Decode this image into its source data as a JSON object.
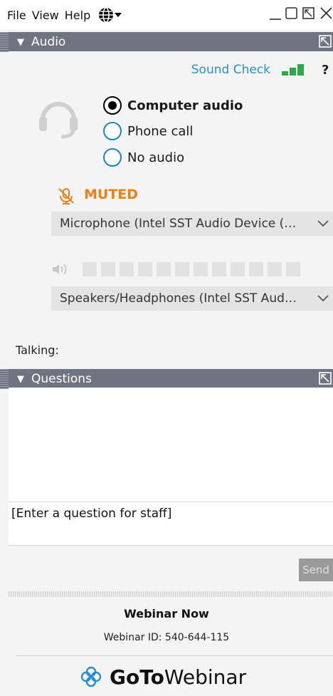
{
  "menu": {
    "file": "File",
    "view": "View",
    "help": "Help"
  },
  "audio": {
    "header": "Audio",
    "sound_check": "Sound Check",
    "help_mark": "?",
    "options": [
      {
        "label": "Computer audio",
        "selected": true
      },
      {
        "label": "Phone call",
        "selected": false
      },
      {
        "label": "No audio",
        "selected": false
      }
    ],
    "muted_label": "MUTED",
    "microphone": "Microphone (Intel SST Audio Device (…",
    "speakers": "Speakers/Headphones (Intel SST Aud…",
    "talking_label": "Talking:"
  },
  "questions": {
    "header": "Questions",
    "input_placeholder": "[Enter a question for staff]",
    "send_label": "Send"
  },
  "footer": {
    "webinar_name": "Webinar Now",
    "webinar_id": "Webinar ID: 540-644-115",
    "brand_goto": "GoTo",
    "brand_rest": "Webinar"
  },
  "colors": {
    "accent_blue": "#2b8ed0",
    "muted_orange": "#f07e10",
    "signal_green": "#2ea84a",
    "panel_header": "#6f7480"
  },
  "icons": {
    "language": "globe-icon",
    "headset": "headset-icon",
    "mic_muted": "mic-muted-icon",
    "speaker": "speaker-icon",
    "popout": "popout-icon",
    "brand": "gotowebinar-logo-icon"
  }
}
